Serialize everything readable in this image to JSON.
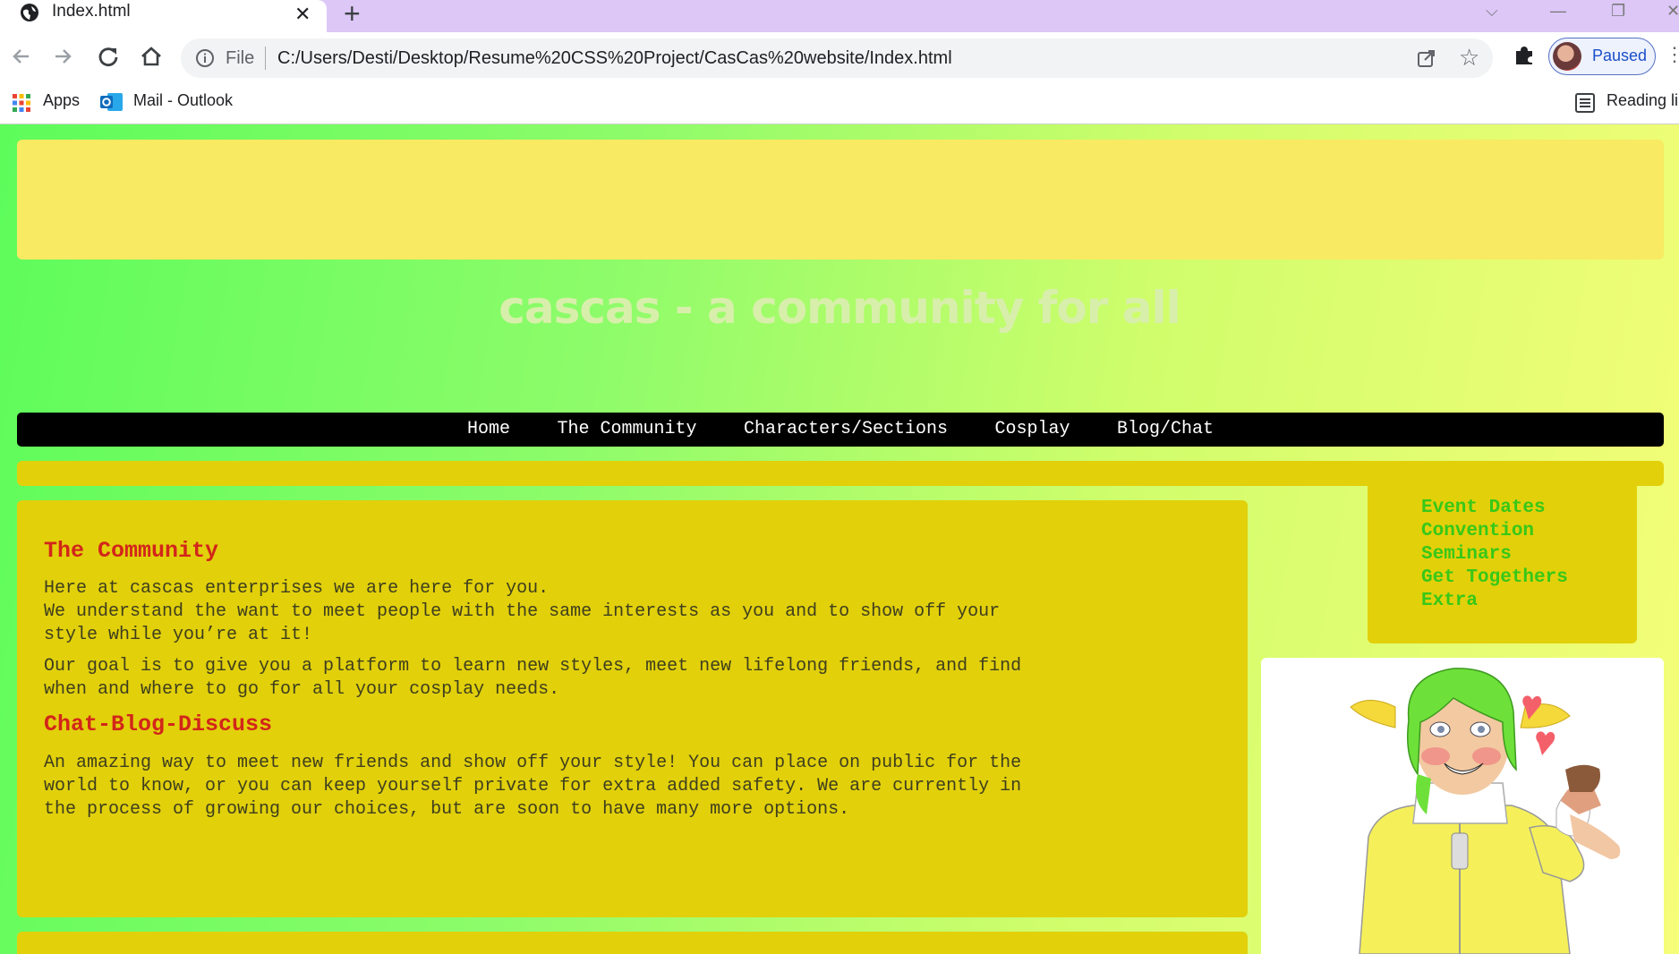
{
  "browser": {
    "tab_title": "Index.html",
    "new_tab_symbol": "+",
    "close_symbol": "✕",
    "file_label": "File",
    "url": "C:/Users/Desti/Desktop/Resume%20CSS%20Project/CasCas%20website/Index.html",
    "profile_label": "Paused",
    "bookmarks": {
      "apps": "Apps",
      "mail": "Mail - Outlook",
      "reading": "Reading li"
    }
  },
  "site": {
    "title": "cascas - a community for all",
    "nav": [
      "Home",
      "The Community",
      "Characters/Sections",
      "Cosplay",
      "Blog/Chat"
    ],
    "sections": [
      {
        "heading": "The Community",
        "paragraphs": [
          "Here at cascas enterprises we are here for you.\nWe understand the want to meet people with the same interests as you and to show off your\nstyle while you’re at it!",
          "Our goal is to give you a platform to learn new styles, meet new lifelong friends, and find\nwhen and where to go for all your cosplay needs."
        ]
      },
      {
        "heading": "Chat-Blog-Discuss",
        "paragraphs": [
          "An amazing way to meet new friends and show off your style! You can place on public for the\nworld to know, or you can keep yourself private for extra added safety. We are currently in\nthe process of growing our choices, but are soon to have many more options."
        ]
      }
    ],
    "sidebar_links": [
      "Event Dates",
      "Convention",
      "Seminars",
      "Get Togethers",
      "Extra"
    ]
  },
  "colors": {
    "accent_green": "#37c818",
    "heading_red": "#d2261a",
    "panel_gold": "#e2d00b",
    "banner_yellow": "#f8ea62",
    "tab_strip": "#dcc7f7"
  },
  "icons": {
    "tab": "globe-icon",
    "back": "back-arrow-icon",
    "forward": "forward-arrow-icon",
    "reload": "reload-icon",
    "home": "home-icon",
    "info": "info-icon",
    "share": "share-icon",
    "star": "star-icon",
    "extensions": "puzzle-icon",
    "reading": "reading-list-icon"
  }
}
